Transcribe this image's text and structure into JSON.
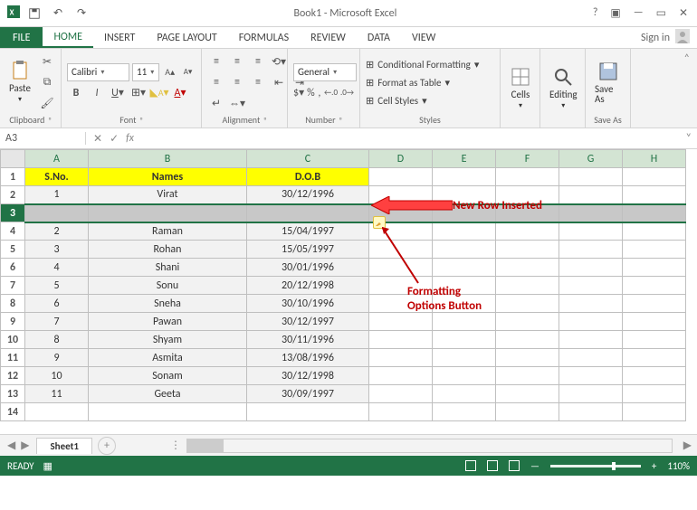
{
  "titlebar": {
    "title": "Book1 - Microsoft Excel"
  },
  "tabs": {
    "file": "FILE",
    "home": "HOME",
    "insert": "INSERT",
    "page_layout": "PAGE LAYOUT",
    "formulas": "FORMULAS",
    "review": "REVIEW",
    "data": "DATA",
    "view": "VIEW",
    "signin": "Sign in"
  },
  "ribbon": {
    "clipboard": {
      "paste": "Paste",
      "label": "Clipboard"
    },
    "font": {
      "family": "Calibri",
      "size": "11",
      "label": "Font"
    },
    "alignment": {
      "label": "Alignment"
    },
    "number": {
      "format": "General",
      "label": "Number"
    },
    "styles": {
      "cond": "Conditional Formatting",
      "table": "Format as Table",
      "cell": "Cell Styles",
      "label": "Styles"
    },
    "cells": {
      "label": "Cells"
    },
    "editing": {
      "label": "Editing"
    },
    "saveas": {
      "big": "Save As",
      "label": "Save As"
    }
  },
  "namebox": "A3",
  "columns": [
    "A",
    "B",
    "C",
    "D",
    "E",
    "F",
    "G",
    "H"
  ],
  "headers": {
    "a": "S.No.",
    "b": "Names",
    "c": "D.O.B"
  },
  "rows": [
    {
      "n": "1",
      "name": "Virat",
      "dob": "30/12/1996"
    },
    {
      "n": "2",
      "name": "Raman",
      "dob": "15/04/1997"
    },
    {
      "n": "3",
      "name": "Rohan",
      "dob": "15/05/1997"
    },
    {
      "n": "4",
      "name": "Shani",
      "dob": "30/01/1996"
    },
    {
      "n": "5",
      "name": "Sonu",
      "dob": "20/12/1998"
    },
    {
      "n": "6",
      "name": "Sneha",
      "dob": "30/10/1996"
    },
    {
      "n": "7",
      "name": "Pawan",
      "dob": "30/12/1997"
    },
    {
      "n": "8",
      "name": "Shyam",
      "dob": "30/11/1996"
    },
    {
      "n": "9",
      "name": "Asmita",
      "dob": "13/08/1996"
    },
    {
      "n": "10",
      "name": "Sonam",
      "dob": "30/12/1998"
    },
    {
      "n": "11",
      "name": "Geeta",
      "dob": "30/09/1997"
    }
  ],
  "row_labels": [
    "1",
    "2",
    "3",
    "4",
    "5",
    "6",
    "7",
    "8",
    "9",
    "10",
    "11",
    "12",
    "13",
    "14"
  ],
  "annotations": {
    "new_row": "New Row Inserted",
    "fmt1": "Formatting",
    "fmt2": "Options Button"
  },
  "sheet": {
    "name": "Sheet1"
  },
  "status": {
    "ready": "READY",
    "zoom": "110%"
  }
}
